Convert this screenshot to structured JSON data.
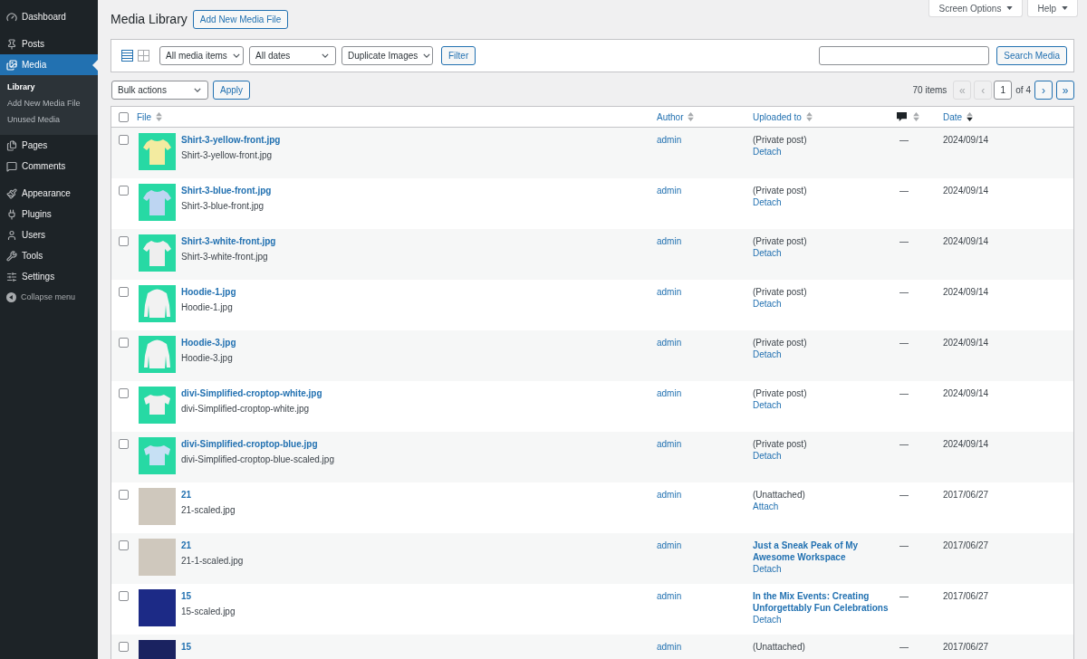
{
  "sidebar": {
    "sections": [
      {
        "items": [
          {
            "label": "Dashboard",
            "selected": false
          }
        ]
      },
      {
        "items": [
          {
            "label": "Posts",
            "selected": false
          },
          {
            "label": "Media",
            "selected": true,
            "children": [
              {
                "label": "Library",
                "selected": true
              },
              {
                "label": "Add New Media File",
                "selected": false
              },
              {
                "label": "Unused Media",
                "selected": false
              }
            ]
          },
          {
            "label": "Pages",
            "selected": false
          },
          {
            "label": "Comments",
            "selected": false
          }
        ]
      },
      {
        "items": [
          {
            "label": "Appearance",
            "selected": false
          },
          {
            "label": "Plugins",
            "selected": false
          },
          {
            "label": "Users",
            "selected": false
          },
          {
            "label": "Tools",
            "selected": false
          },
          {
            "label": "Settings",
            "selected": false
          }
        ]
      }
    ],
    "collapse_label": "Collapse menu"
  },
  "screen_meta": [
    {
      "label": "Screen Options"
    },
    {
      "label": "Help"
    }
  ],
  "header": {
    "title": "Media Library",
    "add_button": "Add New Media File"
  },
  "filter_bar": {
    "view_modes": [
      {
        "selected": true
      },
      {
        "selected": false
      }
    ],
    "filters": [
      "All media items",
      "All dates",
      "Duplicate Images"
    ],
    "filter_button": "Filter",
    "search_button": "Search Media"
  },
  "tablenav": {
    "bulk_actions": "Bulk actions",
    "apply_button": "Apply",
    "item_count": "70 items",
    "pagination": {
      "first": {
        "label": "«",
        "disabled": true
      },
      "prev": {
        "label": "‹",
        "disabled": true
      },
      "current_page": "1",
      "total": "of 4",
      "next": {
        "label": "›",
        "disabled": false
      },
      "last": {
        "label": "»",
        "disabled": false
      }
    }
  },
  "table": {
    "select_all": {
      "checked": false
    },
    "columns": [
      {
        "kind": "text",
        "label": "File",
        "sorted": false
      },
      {
        "kind": "text",
        "label": "Author",
        "sorted": false
      },
      {
        "kind": "text",
        "label": "Uploaded to",
        "sorted": false
      },
      {
        "kind": "icon",
        "sorted": false
      },
      {
        "kind": "text",
        "label": "Date",
        "sorted": true
      }
    ],
    "rows": [
      {
        "checked": false,
        "thumbnail": {
          "kind": "tshirt",
          "color": "#f3eba0"
        },
        "title": "Shirt-3-yellow-front.jpg",
        "filename": "Shirt-3-yellow-front.jpg",
        "author": "admin",
        "uploaded_to": {
          "kind": "note",
          "text": "(Private post)"
        },
        "action": "Detach",
        "comments": "—",
        "date": "2024/09/14"
      },
      {
        "checked": false,
        "thumbnail": {
          "kind": "tshirt",
          "color": "#bdd5f2"
        },
        "title": "Shirt-3-blue-front.jpg",
        "filename": "Shirt-3-blue-front.jpg",
        "author": "admin",
        "uploaded_to": {
          "kind": "note",
          "text": "(Private post)"
        },
        "action": "Detach",
        "comments": "—",
        "date": "2024/09/14"
      },
      {
        "checked": false,
        "thumbnail": {
          "kind": "tshirt",
          "color": "#eeeeee"
        },
        "title": "Shirt-3-white-front.jpg",
        "filename": "Shirt-3-white-front.jpg",
        "author": "admin",
        "uploaded_to": {
          "kind": "note",
          "text": "(Private post)"
        },
        "action": "Detach",
        "comments": "—",
        "date": "2024/09/14"
      },
      {
        "checked": false,
        "thumbnail": {
          "kind": "hoodie",
          "color": "#f2f2f2"
        },
        "title": "Hoodie-1.jpg",
        "filename": "Hoodie-1.jpg",
        "author": "admin",
        "uploaded_to": {
          "kind": "note",
          "text": "(Private post)"
        },
        "action": "Detach",
        "comments": "—",
        "date": "2024/09/14"
      },
      {
        "checked": false,
        "thumbnail": {
          "kind": "hoodie",
          "color": "#f2f2f2"
        },
        "title": "Hoodie-3.jpg",
        "filename": "Hoodie-3.jpg",
        "author": "admin",
        "uploaded_to": {
          "kind": "note",
          "text": "(Private post)"
        },
        "action": "Detach",
        "comments": "—",
        "date": "2024/09/14"
      },
      {
        "checked": false,
        "thumbnail": {
          "kind": "croptop",
          "color": "#f0f0f0"
        },
        "title": "divi-Simplified-croptop-white.jpg",
        "filename": "divi-Simplified-croptop-white.jpg",
        "author": "admin",
        "uploaded_to": {
          "kind": "note",
          "text": "(Private post)"
        },
        "action": "Detach",
        "comments": "—",
        "date": "2024/09/14"
      },
      {
        "checked": false,
        "thumbnail": {
          "kind": "croptop",
          "color": "#c6e0f4"
        },
        "title": "divi-Simplified-croptop-blue.jpg",
        "filename": "divi-Simplified-croptop-blue-scaled.jpg",
        "author": "admin",
        "uploaded_to": {
          "kind": "note",
          "text": "(Private post)"
        },
        "action": "Detach",
        "comments": "—",
        "date": "2024/09/14"
      },
      {
        "checked": false,
        "thumbnail": {
          "kind": "photo",
          "color": "#cfc8bd"
        },
        "title": "21",
        "filename": "21-scaled.jpg",
        "author": "admin",
        "uploaded_to": {
          "kind": "note",
          "text": "(Unattached)"
        },
        "action": "Attach",
        "comments": "—",
        "date": "2017/06/27"
      },
      {
        "checked": false,
        "thumbnail": {
          "kind": "photo",
          "color": "#cfc8bd"
        },
        "title": "21",
        "filename": "21-1-scaled.jpg",
        "author": "admin",
        "uploaded_to": {
          "kind": "post",
          "text": "Just a Sneak Peak of My Awesome Workspace"
        },
        "action": "Detach",
        "comments": "—",
        "date": "2017/06/27"
      },
      {
        "checked": false,
        "thumbnail": {
          "kind": "photo",
          "color": "#1c2a86"
        },
        "title": "15",
        "filename": "15-scaled.jpg",
        "author": "admin",
        "uploaded_to": {
          "kind": "post",
          "text": "In the Mix Events: Creating Unforgettably Fun Celebrations"
        },
        "action": "Detach",
        "comments": "—",
        "date": "2017/06/27"
      },
      {
        "checked": false,
        "thumbnail": {
          "kind": "photo",
          "color": "#1a2260"
        },
        "title": "15",
        "author": "admin",
        "uploaded_to": {
          "kind": "note",
          "text": "(Unattached)"
        },
        "comments": "—",
        "date": "2017/06/27"
      }
    ]
  }
}
